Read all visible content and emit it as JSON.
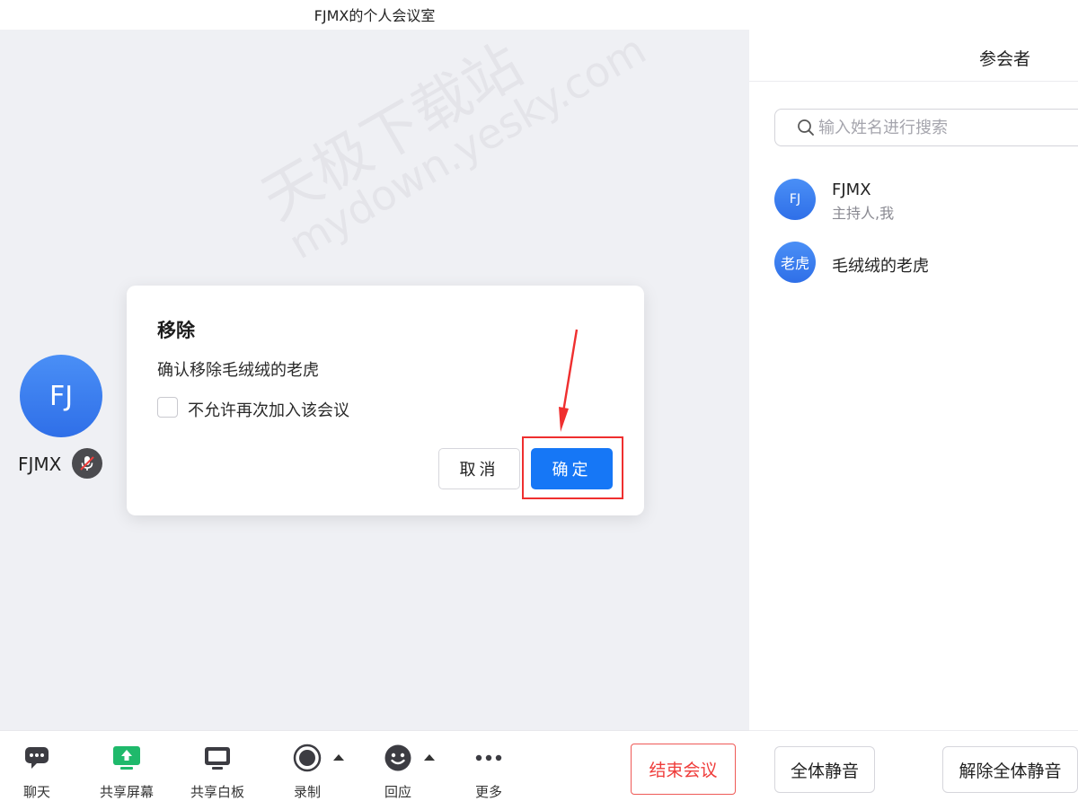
{
  "window": {
    "title": "FJMX的个人会议室"
  },
  "stage": {
    "watermark": {
      "line1": "天极下载站",
      "line2": "mydown.yesky.com"
    },
    "self_tile": {
      "avatar_initials": "FJ",
      "name": "FJMX",
      "mic_status": "muted",
      "mic_icon": "mic-muted-icon"
    }
  },
  "dialog": {
    "title": "移除",
    "message": "确认移除毛绒绒的老虎",
    "checkbox_label": "不允许再次加入该会议",
    "checkbox_checked": false,
    "cancel_label": "取消",
    "confirm_label": "确定",
    "confirm_color": "#1677f6",
    "highlight_color": "#ef2f2f"
  },
  "toolbar": {
    "items": [
      {
        "label": "聊天",
        "icon": "chat-icon"
      },
      {
        "label": "共享屏幕",
        "icon": "share-screen-icon",
        "color": "#1fb96b"
      },
      {
        "label": "共享白板",
        "icon": "whiteboard-icon"
      },
      {
        "label": "录制",
        "icon": "record-icon"
      },
      {
        "label": "回应",
        "icon": "emoji-icon"
      },
      {
        "label": "更多",
        "icon": "more-icon"
      }
    ],
    "end_label": "结束会议",
    "end_color": "#ef3c3a"
  },
  "participants_panel": {
    "title": "参会者",
    "search_placeholder": "输入姓名进行搜索",
    "members": [
      {
        "avatar_text": "FJ",
        "name": "FJMX",
        "role": "主持人,我"
      },
      {
        "avatar_text": "老虎",
        "name": "毛绒绒的老虎",
        "role": ""
      }
    ],
    "mute_all_label": "全体静音",
    "unmute_all_label": "解除全体静音"
  }
}
